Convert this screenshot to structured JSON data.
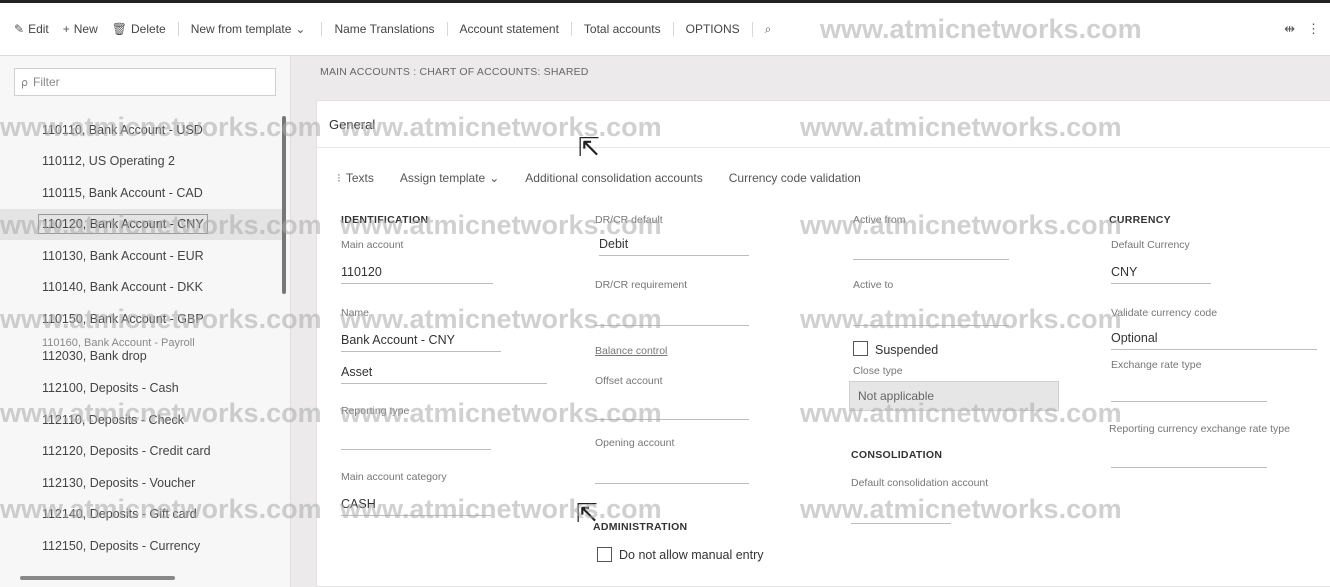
{
  "toolbar": {
    "edit": "Edit",
    "new": "New",
    "delete": "Delete",
    "new_from_template": "New from template",
    "name_translations": "Name Translations",
    "account_statement": "Account statement",
    "total_accounts": "Total accounts",
    "options": "OPTIONS"
  },
  "sidebar": {
    "filter_placeholder": "Filter",
    "accounts": [
      "110110, Bank Account - USD",
      "110112, US Operating 2",
      "110115, Bank Account - CAD",
      "110120, Bank Account - CNY",
      "110130, Bank Account - EUR",
      "110140, Bank Account - DKK",
      "110150, Bank Account - GBP",
      "110160, Bank Account - Payroll",
      "112030, Bank drop",
      "112100, Deposits - Cash",
      "112110, Deposits - Check",
      "112120, Deposits - Credit card",
      "112130, Deposits - Voucher",
      "112140, Deposits - Gift card",
      "112150, Deposits - Currency"
    ],
    "selected_index": 3
  },
  "breadcrumb": "MAIN ACCOUNTS : CHART OF ACCOUNTS: SHARED",
  "panel": {
    "title": "General",
    "subtoolbar": {
      "texts": "Texts",
      "assign_template": "Assign template",
      "additional_consolidation": "Additional consolidation accounts",
      "currency_validation": "Currency code validation"
    },
    "identification": {
      "heading": "IDENTIFICATION",
      "main_account_label": "Main account",
      "main_account_value": "110120",
      "name_label": "Name",
      "name_value": "Bank Account - CNY",
      "type_value": "Asset",
      "reporting_type_label": "Reporting type",
      "category_label": "Main account category",
      "category_value": "CASH"
    },
    "debit_credit": {
      "default_label": "DR/CR default",
      "default_value": "Debit",
      "requirement_label": "DR/CR requirement",
      "balance_control_label": "Balance control",
      "offset_label": "Offset account",
      "opening_label": "Opening account"
    },
    "administration": {
      "heading": "ADMINISTRATION",
      "manual_entry_label": "Do not allow manual entry"
    },
    "status": {
      "active_from_label": "Active from",
      "active_to_label": "Active to",
      "suspended_label": "Suspended",
      "close_type_label": "Close type",
      "close_type_value": "Not applicable"
    },
    "consolidation": {
      "heading": "CONSOLIDATION",
      "default_label": "Default consolidation account"
    },
    "currency": {
      "heading": "CURRENCY",
      "default_currency_label": "Default Currency",
      "default_currency_value": "CNY",
      "validate_label": "Validate currency code",
      "validate_value": "Optional",
      "exchange_rate_label": "Exchange rate type",
      "reporting_exchange_label": "Reporting currency exchange rate type"
    }
  },
  "watermark": "www.atmicnetworks.com"
}
